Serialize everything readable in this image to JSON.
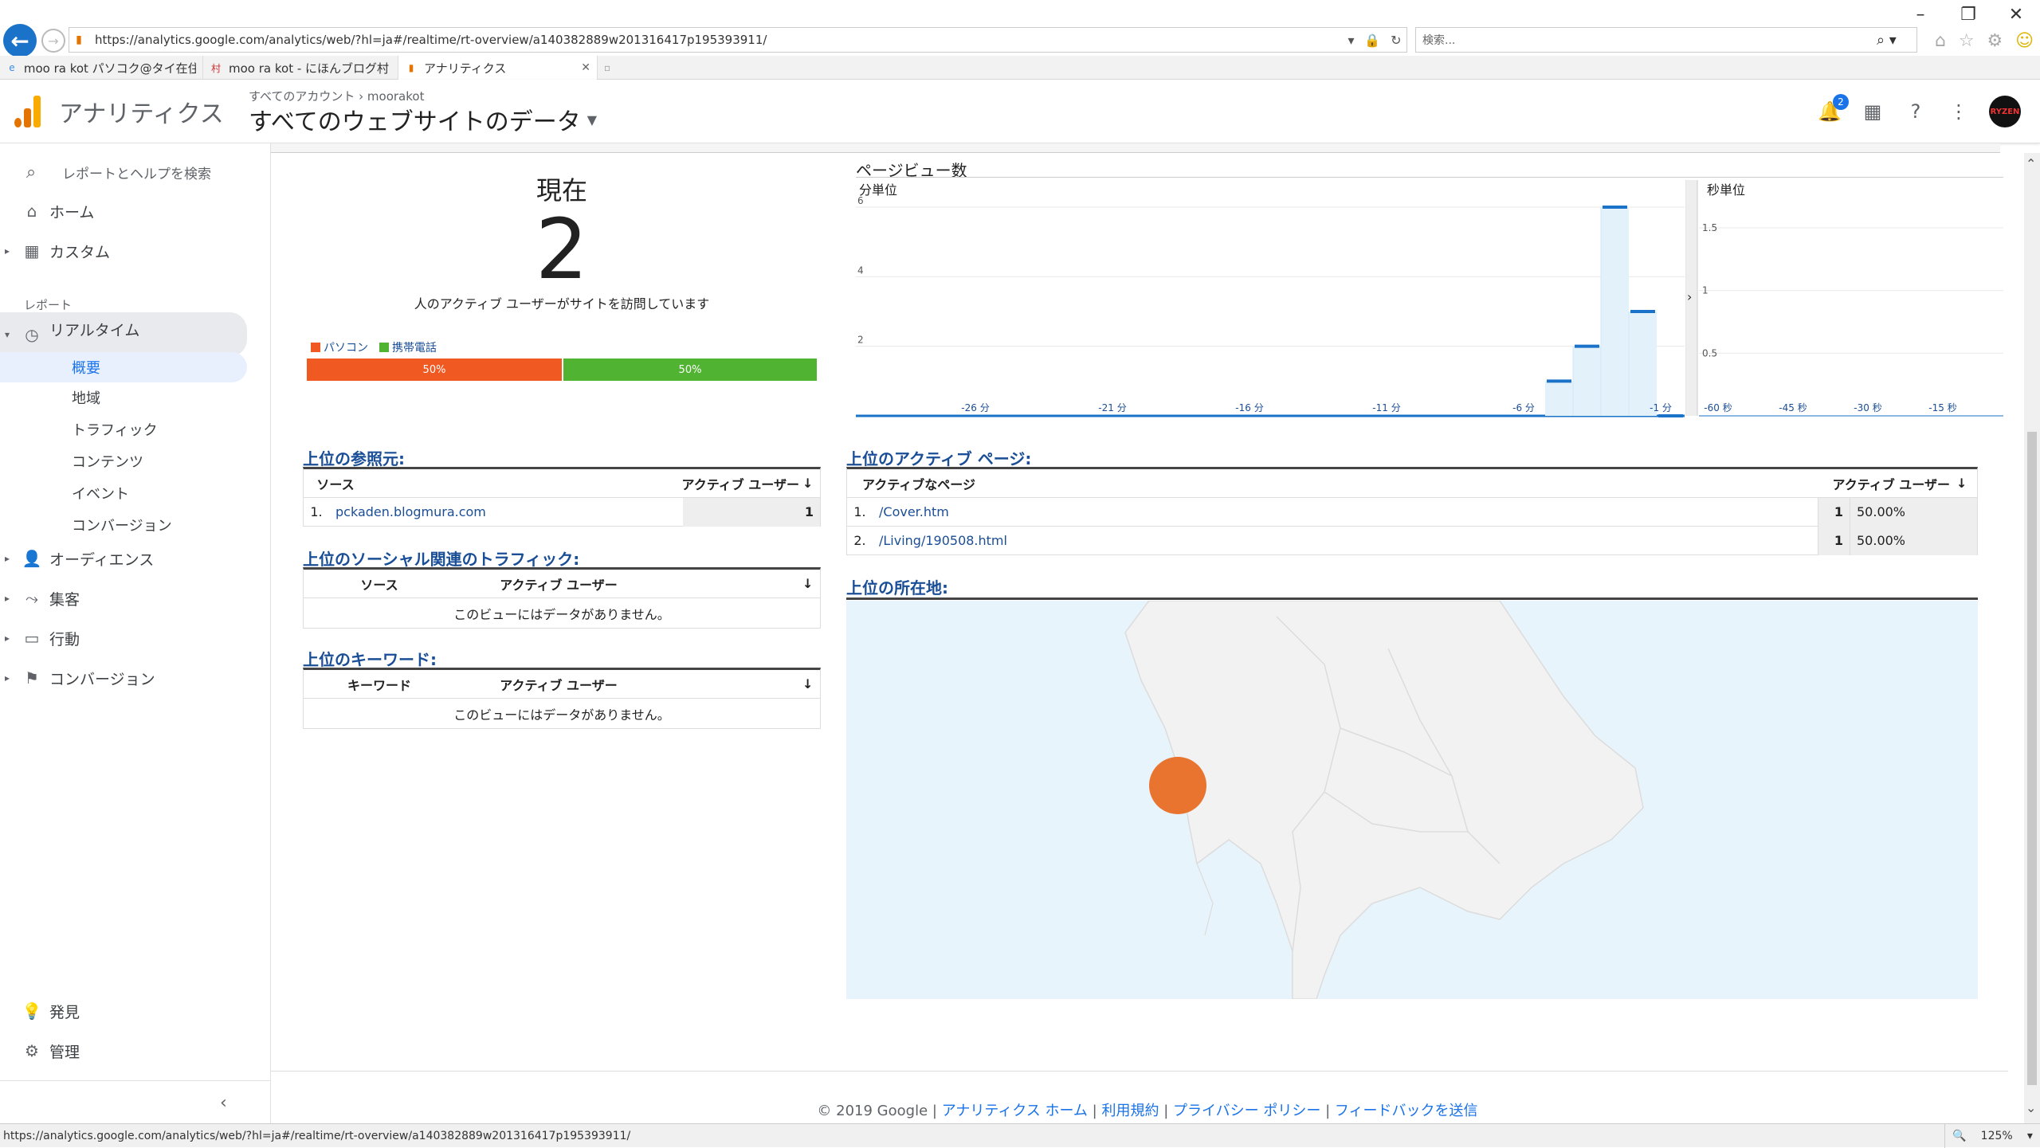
{
  "browser": {
    "url": "https://analytics.google.com/analytics/web/?hl=ja#/realtime/rt-overview/a140382889w201316417p195393911/",
    "search_placeholder": "検索...",
    "tabs": [
      {
        "label": "moo ra kot パソコク@タイ在住／..."
      },
      {
        "label": "moo ra kot - にほんブログ村"
      },
      {
        "label": "アナリティクス"
      }
    ]
  },
  "ga_header": {
    "app_title": "アナリティクス",
    "breadcrumb_all": "すべてのアカウント",
    "breadcrumb_sep": "›",
    "breadcrumb_account": "moorakot",
    "property": "すべてのウェブサイトのデータ",
    "notification_count": "2",
    "avatar_text": "RYZEN"
  },
  "sidebar": {
    "search": "レポートとヘルプを検索",
    "home": "ホーム",
    "custom": "カスタム",
    "reports_section": "レポート",
    "realtime": "リアルタイム",
    "realtime_sub": [
      "概要",
      "地域",
      "トラフィック",
      "コンテンツ",
      "イベント",
      "コンバージョン"
    ],
    "audience": "オーディエンス",
    "acquisition": "集客",
    "behavior": "行動",
    "conversion": "コンバージョン",
    "discover": "発見",
    "admin": "管理"
  },
  "now": {
    "label": "現在",
    "count": "2",
    "desc": "人のアクティブ ユーザーがサイトを訪問しています",
    "legend_desktop": "パソコン",
    "legend_mobile": "携帯電話",
    "desktop_pct": "50%",
    "mobile_pct": "50%",
    "desktop_share": 0.5,
    "color_desktop": "#f05922",
    "color_mobile": "#50b432"
  },
  "chart_data": [
    {
      "type": "bar",
      "title": "ページビュー数",
      "subtitle": "分単位",
      "yticks": [
        "2",
        "4",
        "6"
      ],
      "ylim": [
        0,
        6
      ],
      "xticks": [
        "-26 分",
        "-21 分",
        "-16 分",
        "-11 分",
        "-6 分",
        "-1 分"
      ],
      "categories": [
        "-5",
        "-4",
        "-3",
        "-2",
        "-1"
      ],
      "values": [
        1,
        2,
        6,
        3,
        0
      ]
    },
    {
      "type": "bar",
      "subtitle": "秒単位",
      "yticks": [
        "0.5",
        "1",
        "1.5"
      ],
      "ylim": [
        0,
        1.5
      ],
      "xticks": [
        "-60 秒",
        "-45 秒",
        "-30 秒",
        "-15 秒"
      ],
      "values": []
    }
  ],
  "referrals": {
    "title": "上位の参照元:",
    "col_source": "ソース",
    "col_users": "アクティブ ユーザー",
    "rows": [
      {
        "num": "1.",
        "source": "pckaden.blogmura.com",
        "users": "1"
      }
    ]
  },
  "social": {
    "title": "上位のソーシャル関連のトラフィック:",
    "col_source": "ソース",
    "col_users": "アクティブ ユーザー",
    "empty": "このビューにはデータがありません。"
  },
  "keywords": {
    "title": "上位のキーワード:",
    "col_keyword": "キーワード",
    "col_users": "アクティブ ユーザー",
    "empty": "このビューにはデータがありません。"
  },
  "active_pages": {
    "title": "上位のアクティブ ページ:",
    "col_page": "アクティブなページ",
    "col_users": "アクティブ ユーザー",
    "rows": [
      {
        "num": "1.",
        "page": "/Cover.htm",
        "users": "1",
        "pct": "50.00%"
      },
      {
        "num": "2.",
        "page": "/Living/190508.html",
        "users": "1",
        "pct": "50.00%"
      }
    ]
  },
  "locations": {
    "title": "上位の所在地:"
  },
  "footer": {
    "copyright": "© 2019 Google",
    "sep": "|",
    "links": [
      "アナリティクス ホーム",
      "利用規約",
      "プライバシー ポリシー",
      "フィードバックを送信"
    ]
  },
  "statusbar": {
    "url": "https://analytics.google.com/analytics/web/?hl=ja#/realtime/rt-overview/a140382889w201316417p195393911/",
    "zoom": "125%"
  },
  "icons": {
    "back": "back-arrow-icon",
    "forward": "forward-arrow-icon",
    "search": "search-icon",
    "bell": "bell-icon",
    "apps": "apps-grid-icon",
    "help": "help-icon",
    "more": "more-vert-icon"
  }
}
